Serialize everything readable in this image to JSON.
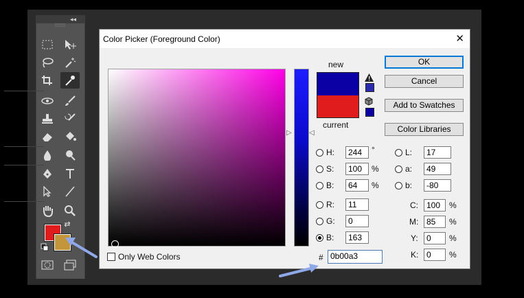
{
  "dialog": {
    "title": "Color Picker (Foreground Color)",
    "close_label": "✕",
    "new_label": "new",
    "current_label": "current",
    "new_color": "#0b00a3",
    "current_color": "#e01c1c",
    "buttons": {
      "ok": "OK",
      "cancel": "Cancel",
      "add_to_swatches": "Add to Swatches",
      "color_libraries": "Color Libraries"
    },
    "hsb": {
      "h_label": "H:",
      "h_value": "244",
      "h_unit": "°",
      "s_label": "S:",
      "s_value": "100",
      "s_unit": "%",
      "b_label": "B:",
      "b_value": "64",
      "b_unit": "%"
    },
    "rgb": {
      "r_label": "R:",
      "r_value": "11",
      "g_label": "G:",
      "g_value": "0",
      "b_label": "B:",
      "b_value": "163",
      "selected": "B"
    },
    "lab": {
      "l_label": "L:",
      "l_value": "17",
      "a_label": "a:",
      "a_value": "49",
      "b_label": "b:",
      "b_value": "-80"
    },
    "cmyk": {
      "c_label": "C:",
      "c_value": "100",
      "m_label": "M:",
      "m_value": "85",
      "y_label": "Y:",
      "y_value": "0",
      "k_label": "K:",
      "k_value": "0",
      "unit": "%"
    },
    "hex_label": "#",
    "hex_value": "0b00a3",
    "only_web_colors": "Only Web Colors",
    "warning_icons": [
      "out-of-gamut-warning-icon",
      "not-web-safe-cube-icon"
    ]
  },
  "toolbar": {
    "collapse_label": "◂◂",
    "foreground_color": "#e01c1c",
    "background_color": "#c4963c",
    "tools": [
      "marquee-icon",
      "move-icon",
      "lasso-icon",
      "magic-wand-icon",
      "crop-icon",
      "eyedropper-icon",
      "healing-icon",
      "brush-icon",
      "stamp-icon",
      "history-brush-icon",
      "eraser-icon",
      "fill-icon",
      "blur-icon",
      "dodge-icon",
      "pen-icon",
      "type-icon",
      "path-select-icon",
      "line-icon",
      "hand-icon",
      "zoom-icon"
    ]
  }
}
